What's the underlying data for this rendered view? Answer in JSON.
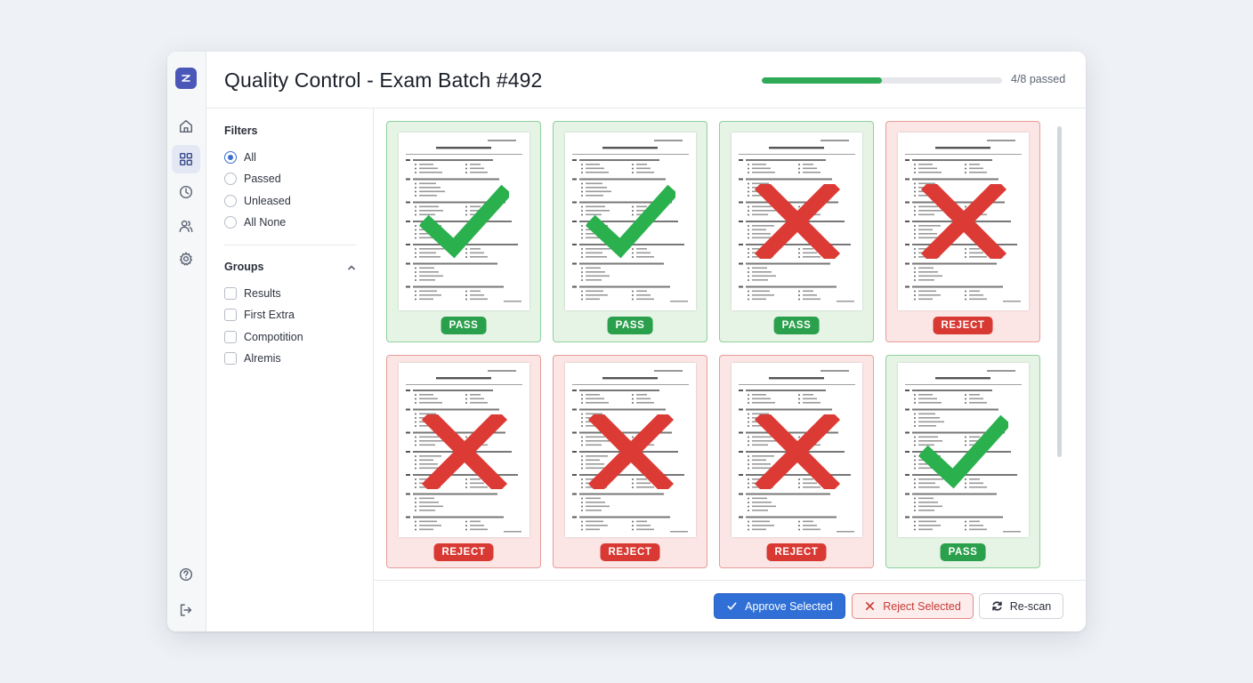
{
  "header": {
    "title": "Quality Control - Exam Batch #492",
    "progress_text": "4/8 passed",
    "progress_fraction": 0.5
  },
  "rail": {
    "items": [
      {
        "name": "home",
        "icon": "home-icon",
        "active": false
      },
      {
        "name": "grid",
        "icon": "grid-icon",
        "active": true
      },
      {
        "name": "history",
        "icon": "clock-icon",
        "active": false
      },
      {
        "name": "users",
        "icon": "users-icon",
        "active": false
      },
      {
        "name": "settings",
        "icon": "gear-icon",
        "active": false
      }
    ],
    "bottom": [
      {
        "name": "help",
        "icon": "help-icon"
      },
      {
        "name": "logout",
        "icon": "logout-icon"
      }
    ]
  },
  "filters": {
    "heading": "Filters",
    "options": [
      "All",
      "Passed",
      "Unleased",
      "All None"
    ],
    "selected": "All"
  },
  "groups": {
    "heading": "Groups",
    "items": [
      "Results",
      "First Extra",
      "Compotition",
      "Alremis"
    ]
  },
  "cards": [
    {
      "status": "pass",
      "badge": "PASS",
      "mark": "check"
    },
    {
      "status": "pass",
      "badge": "PASS",
      "mark": "check"
    },
    {
      "status": "pass",
      "badge": "PASS",
      "mark": "cross"
    },
    {
      "status": "reject",
      "badge": "REJECT",
      "mark": "cross"
    },
    {
      "status": "reject",
      "badge": "REJECT",
      "mark": "cross"
    },
    {
      "status": "reject",
      "badge": "REJECT",
      "mark": "cross"
    },
    {
      "status": "reject",
      "badge": "REJECT",
      "mark": "cross"
    },
    {
      "status": "pass",
      "badge": "PASS",
      "mark": "check"
    }
  ],
  "actions": {
    "approve": "Approve Selected",
    "reject": "Reject Selected",
    "rescan": "Re-scan"
  },
  "colors": {
    "pass": "#2ba04c",
    "reject": "#d83a33",
    "accent": "#2f6fd6"
  }
}
